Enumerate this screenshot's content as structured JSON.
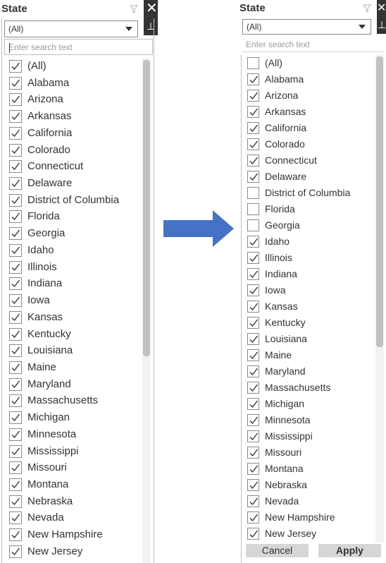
{
  "arrow_color": "#4472c4",
  "left": {
    "title": "State",
    "dropdown_value": "(All)",
    "search_placeholder": "Enter search text",
    "items": [
      {
        "label": "(All)",
        "checked": true
      },
      {
        "label": "Alabama",
        "checked": true
      },
      {
        "label": "Arizona",
        "checked": true
      },
      {
        "label": "Arkansas",
        "checked": true
      },
      {
        "label": "California",
        "checked": true
      },
      {
        "label": "Colorado",
        "checked": true
      },
      {
        "label": "Connecticut",
        "checked": true
      },
      {
        "label": "Delaware",
        "checked": true
      },
      {
        "label": "District of Columbia",
        "checked": true
      },
      {
        "label": "Florida",
        "checked": true
      },
      {
        "label": "Georgia",
        "checked": true
      },
      {
        "label": "Idaho",
        "checked": true
      },
      {
        "label": "Illinois",
        "checked": true
      },
      {
        "label": "Indiana",
        "checked": true
      },
      {
        "label": "Iowa",
        "checked": true
      },
      {
        "label": "Kansas",
        "checked": true
      },
      {
        "label": "Kentucky",
        "checked": true
      },
      {
        "label": "Louisiana",
        "checked": true
      },
      {
        "label": "Maine",
        "checked": true
      },
      {
        "label": "Maryland",
        "checked": true
      },
      {
        "label": "Massachusetts",
        "checked": true
      },
      {
        "label": "Michigan",
        "checked": true
      },
      {
        "label": "Minnesota",
        "checked": true
      },
      {
        "label": "Mississippi",
        "checked": true
      },
      {
        "label": "Missouri",
        "checked": true
      },
      {
        "label": "Montana",
        "checked": true
      },
      {
        "label": "Nebraska",
        "checked": true
      },
      {
        "label": "Nevada",
        "checked": true
      },
      {
        "label": "New Hampshire",
        "checked": true
      },
      {
        "label": "New Jersey",
        "checked": true
      }
    ]
  },
  "right": {
    "title": "State",
    "dropdown_value": "(All)",
    "search_placeholder": "Enter search text",
    "cancel_label": "Cancel",
    "apply_label": "Apply",
    "items": [
      {
        "label": "(All)",
        "checked": false
      },
      {
        "label": "Alabama",
        "checked": true
      },
      {
        "label": "Arizona",
        "checked": true
      },
      {
        "label": "Arkansas",
        "checked": true
      },
      {
        "label": "California",
        "checked": true
      },
      {
        "label": "Colorado",
        "checked": true
      },
      {
        "label": "Connecticut",
        "checked": true
      },
      {
        "label": "Delaware",
        "checked": true
      },
      {
        "label": "District of Columbia",
        "checked": false
      },
      {
        "label": "Florida",
        "checked": false
      },
      {
        "label": "Georgia",
        "checked": false
      },
      {
        "label": "Idaho",
        "checked": true
      },
      {
        "label": "Illinois",
        "checked": true
      },
      {
        "label": "Indiana",
        "checked": true
      },
      {
        "label": "Iowa",
        "checked": true
      },
      {
        "label": "Kansas",
        "checked": true
      },
      {
        "label": "Kentucky",
        "checked": true
      },
      {
        "label": "Louisiana",
        "checked": true
      },
      {
        "label": "Maine",
        "checked": true
      },
      {
        "label": "Maryland",
        "checked": true
      },
      {
        "label": "Massachusetts",
        "checked": true
      },
      {
        "label": "Michigan",
        "checked": true
      },
      {
        "label": "Minnesota",
        "checked": true
      },
      {
        "label": "Mississippi",
        "checked": true
      },
      {
        "label": "Missouri",
        "checked": true
      },
      {
        "label": "Montana",
        "checked": true
      },
      {
        "label": "Nebraska",
        "checked": true
      },
      {
        "label": "Nevada",
        "checked": true
      },
      {
        "label": "New Hampshire",
        "checked": true
      },
      {
        "label": "New Jersey",
        "checked": true
      }
    ]
  }
}
